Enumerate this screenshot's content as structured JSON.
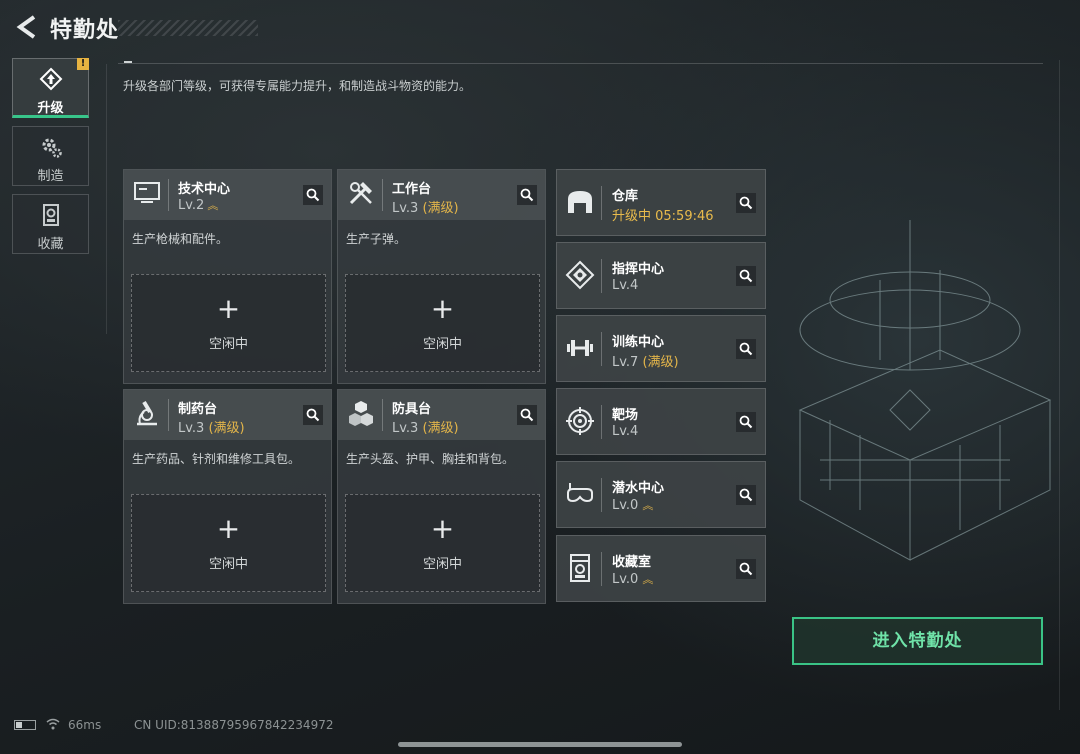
{
  "header": {
    "title": "特勤处"
  },
  "description": "升级各部门等级，可获得专属能力提升，和制造战斗物资的能力。",
  "sidebar": {
    "items": [
      {
        "label": "升级",
        "icon": "upgrade-icon",
        "active": true,
        "badge": "!"
      },
      {
        "label": "制造",
        "icon": "gear-icon",
        "active": false
      },
      {
        "label": "收藏",
        "icon": "collection-icon",
        "active": false
      }
    ]
  },
  "departments": [
    {
      "name": "技术中心",
      "level": "Lv.2",
      "max": "",
      "icon": "monitor-icon",
      "desc": "生产枪械和配件。",
      "slot_status": "空闲中"
    },
    {
      "name": "工作台",
      "level": "Lv.3",
      "max": "(满级)",
      "icon": "tools-icon",
      "desc": "生产子弹。",
      "slot_status": "空闲中"
    },
    {
      "name": "制药台",
      "level": "Lv.3",
      "max": "(满级)",
      "icon": "microscope-icon",
      "desc": "生产药品、针剂和维修工具包。",
      "slot_status": "空闲中"
    },
    {
      "name": "防具台",
      "level": "Lv.3",
      "max": "(满级)",
      "icon": "armor-blocks-icon",
      "desc": "生产头盔、护甲、胸挂和背包。",
      "slot_status": "空闲中"
    }
  ],
  "facilities": [
    {
      "name": "仓库",
      "level": "升级中 05:59:46",
      "icon": "warehouse-icon",
      "upgrading": true
    },
    {
      "name": "指挥中心",
      "level": "Lv.4",
      "icon": "command-icon"
    },
    {
      "name": "训练中心",
      "level": "Lv.7",
      "max": "(满级)",
      "icon": "dumbbell-icon"
    },
    {
      "name": "靶场",
      "level": "Lv.4",
      "icon": "target-icon"
    },
    {
      "name": "潜水中心",
      "level": "Lv.0",
      "icon": "diving-mask-icon",
      "upgradable": true
    },
    {
      "name": "收藏室",
      "level": "Lv.0",
      "icon": "vault-icon",
      "upgradable": true
    }
  ],
  "enter_button": "进入特勤处",
  "status": {
    "ping": "66ms",
    "uid": "CN UID:8138879596784223​4972"
  },
  "colors": {
    "accent_green": "#3ac386",
    "gold": "#e3b54a",
    "panel": "#343a3d"
  }
}
